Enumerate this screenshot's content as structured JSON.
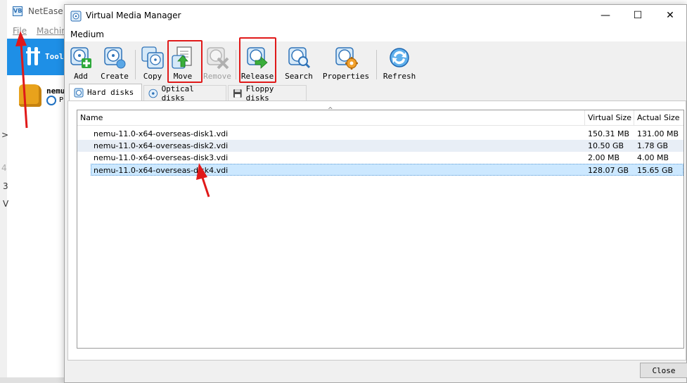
{
  "background_window": {
    "title": "NetEase V",
    "menu": [
      "File",
      "Machin"
    ],
    "tools_label": "Tool",
    "vm_name": "nemu",
    "vm_state": "P",
    "fragments": [
      "3",
      "V",
      ">",
      "4"
    ]
  },
  "dialog": {
    "title": "Virtual Media Manager",
    "menu_medium": "Medium",
    "window_buttons": {
      "minimize": "—",
      "maximize": "☐",
      "close": "✕"
    }
  },
  "toolbar": {
    "add": "Add",
    "create": "Create",
    "copy": "Copy",
    "move": "Move",
    "remove": "Remove",
    "release": "Release",
    "search": "Search",
    "properties": "Properties",
    "refresh": "Refresh"
  },
  "tabs": {
    "hard_disks": "Hard disks",
    "optical_disks": "Optical disks",
    "floppy_disks": "Floppy disks"
  },
  "table": {
    "headers": {
      "name": "Name",
      "virtual_size": "Virtual Size",
      "actual_size": "Actual Size"
    },
    "rows": [
      {
        "name": "nemu-11.0-x64-overseas-disk1.vdi",
        "virtual_size": "150.31 MB",
        "actual_size": "131.00 MB"
      },
      {
        "name": "nemu-11.0-x64-overseas-disk2.vdi",
        "virtual_size": "10.50 GB",
        "actual_size": "1.78 GB"
      },
      {
        "name": "nemu-11.0-x64-overseas-disk3.vdi",
        "virtual_size": "2.00 MB",
        "actual_size": "4.00 MB"
      },
      {
        "name": "nemu-11.0-x64-overseas-disk4.vdi",
        "virtual_size": "128.07 GB",
        "actual_size": "15.65 GB"
      }
    ]
  },
  "close_label": "Close",
  "colors": {
    "annotation": "#e01919",
    "selection": "#cce8ff",
    "alt_row": "#e8eef6",
    "tools_bg": "#1e8fe6"
  }
}
